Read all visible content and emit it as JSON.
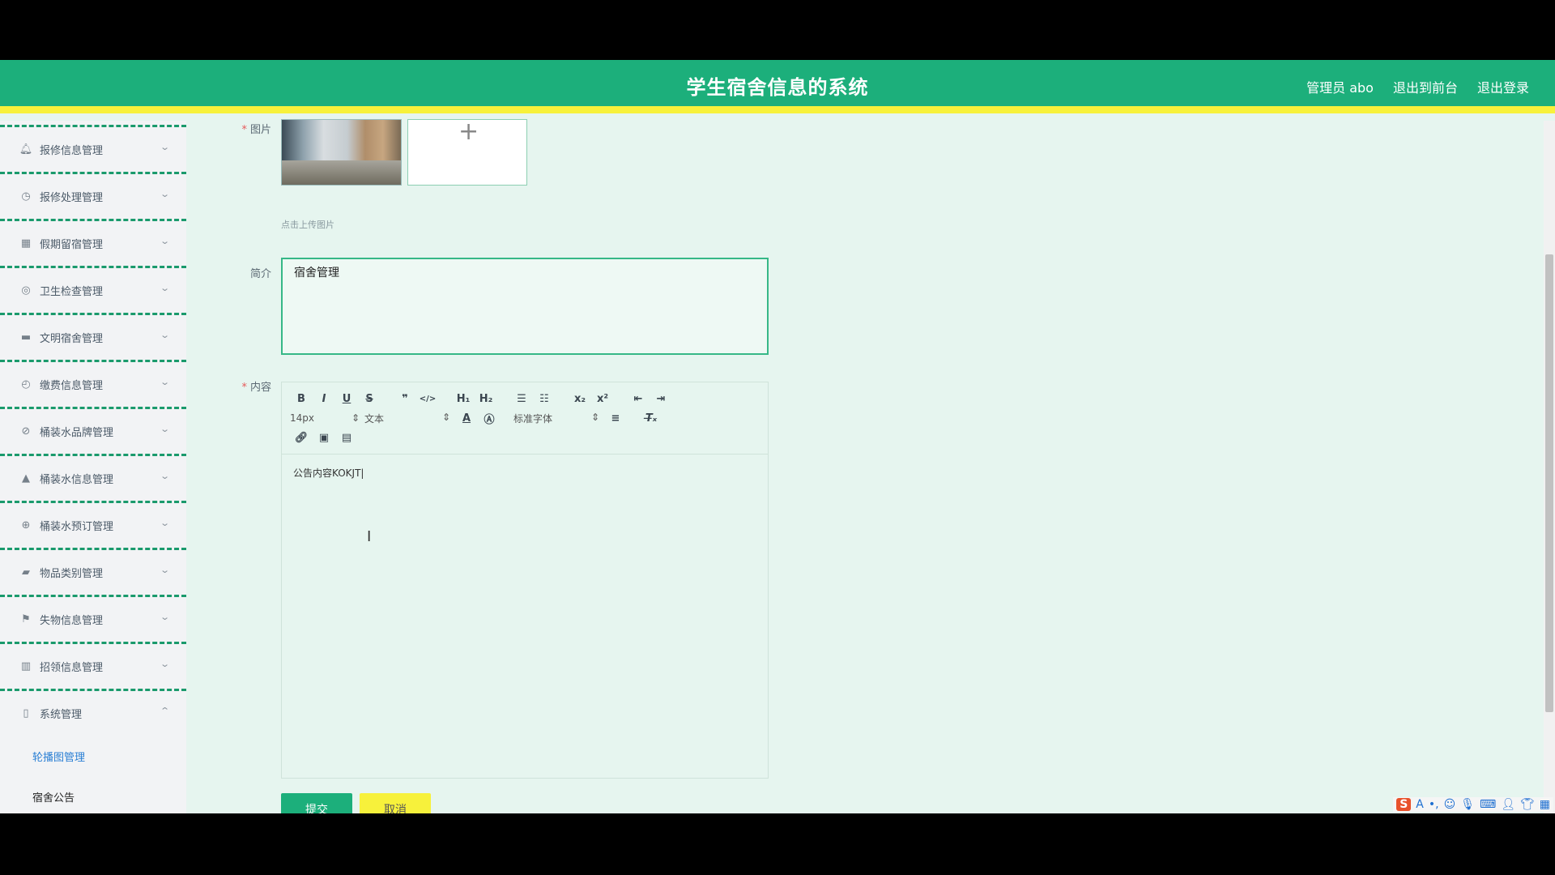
{
  "header": {
    "title": "学生宿舍信息的系统",
    "user": "管理员 abo",
    "to_front": "退出到前台",
    "logout": "退出登录"
  },
  "sidebar": {
    "items": [
      {
        "label": "报修信息管理",
        "icon": "bell-icon"
      },
      {
        "label": "报修处理管理",
        "icon": "gauge-icon"
      },
      {
        "label": "假期留宿管理",
        "icon": "grid-icon"
      },
      {
        "label": "卫生检查管理",
        "icon": "target-icon"
      },
      {
        "label": "文明宿舍管理",
        "icon": "chat-icon"
      },
      {
        "label": "缴费信息管理",
        "icon": "clock-icon"
      },
      {
        "label": "桶装水品牌管理",
        "icon": "compass-icon"
      },
      {
        "label": "桶装水信息管理",
        "icon": "user-icon"
      },
      {
        "label": "桶装水预订管理",
        "icon": "crosshair-icon"
      },
      {
        "label": "物品类别管理",
        "icon": "ticket-icon"
      },
      {
        "label": "失物信息管理",
        "icon": "flag-icon"
      },
      {
        "label": "招领信息管理",
        "icon": "chart-icon"
      },
      {
        "label": "系统管理",
        "icon": "mic-icon"
      }
    ],
    "sub_items": [
      {
        "label": "轮播图管理"
      },
      {
        "label": "宿舍公告"
      }
    ]
  },
  "form": {
    "image_label": "图片",
    "upload_tip": "点击上传图片",
    "intro_label": "简介",
    "intro_value": "宿舍管理",
    "content_label": "内容",
    "content_value": "公告内容KOKJT",
    "submit": "提交",
    "cancel": "取消"
  },
  "editor_toolbar": {
    "size": "14px",
    "header": "文本",
    "font": "标准字体"
  },
  "ime": {
    "logo": "S",
    "mode": "A"
  },
  "colors": {
    "primary": "#1caf7b",
    "accent_yellow": "#f7f13b",
    "background": "#e6f5ef"
  }
}
